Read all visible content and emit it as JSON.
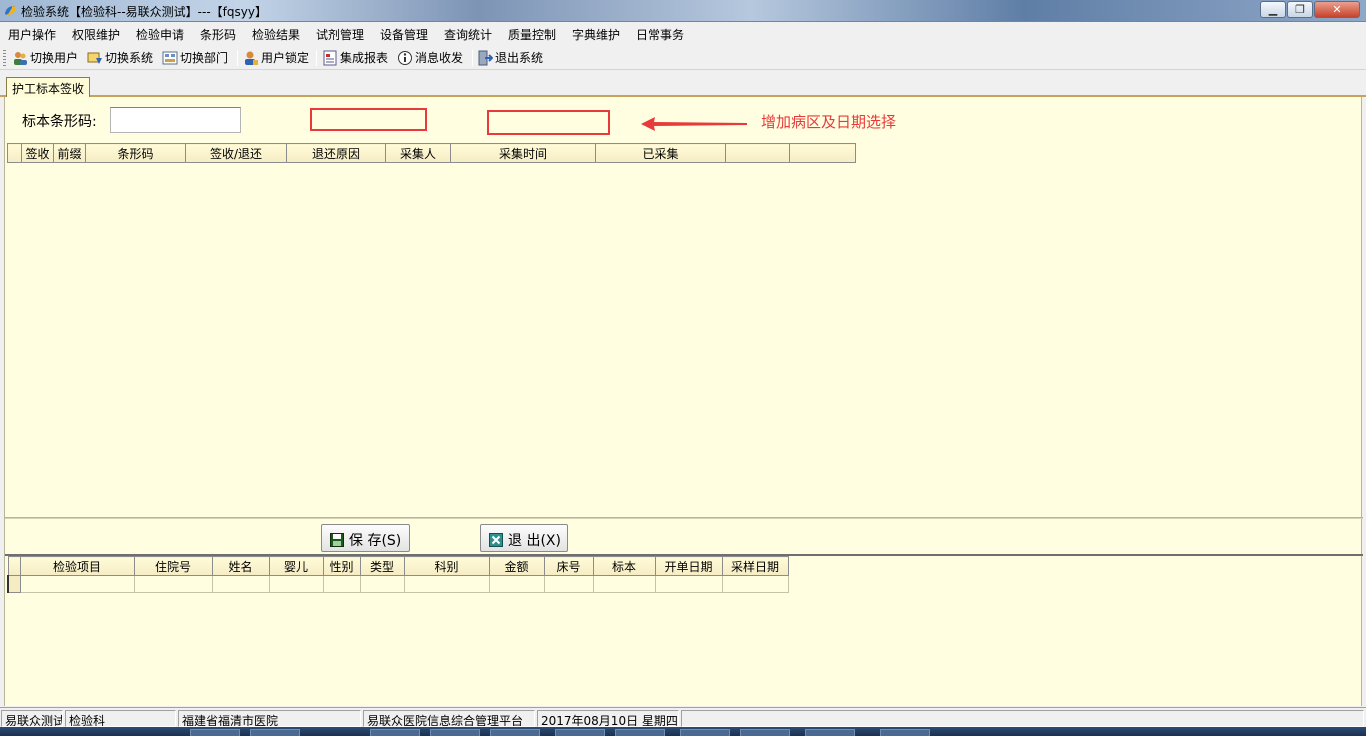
{
  "window": {
    "title": "检验系统【检验科--易联众测试】---【fqsyy】"
  },
  "menu": [
    "用户操作",
    "权限维护",
    "检验申请",
    "条形码",
    "检验结果",
    "试剂管理",
    "设备管理",
    "查询统计",
    "质量控制",
    "字典维护",
    "日常事务"
  ],
  "toolbar": {
    "switch_user": "切换用户",
    "switch_system": "切换系统",
    "switch_dept": "切换部门",
    "user_lock": "用户锁定",
    "report": "集成报表",
    "messages": "消息收发",
    "exit": "退出系统"
  },
  "tab": {
    "label": "护工标本签收"
  },
  "form": {
    "barcode_label": "标本条形码:",
    "barcode_value": ""
  },
  "annotation": {
    "text": "增加病区及日期选择",
    "color": "#e83a3a"
  },
  "upper_grid": {
    "columns": [
      "签收",
      "前缀",
      "条形码",
      "签收/退还",
      "退还原因",
      "采集人",
      "采集时间",
      "已采集",
      "",
      ""
    ]
  },
  "buttons": {
    "save": "保 存(S)",
    "exit": "退 出(X)"
  },
  "lower_grid": {
    "columns": [
      "检验项目",
      "住院号",
      "姓名",
      "婴儿",
      "性别",
      "类型",
      "科别",
      "金额",
      "床号",
      "标本",
      "开单日期",
      "采样日期"
    ]
  },
  "status": {
    "user": "易联众测试",
    "dept": "检验科",
    "hospital": "福建省福清市医院",
    "platform": "易联众医院信息综合管理平台",
    "date": "2017年08月10日  星期四"
  }
}
